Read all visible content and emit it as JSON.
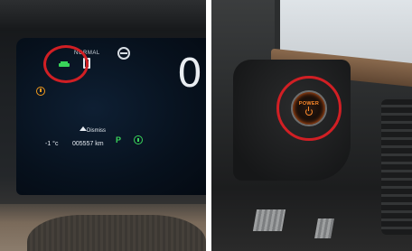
{
  "left_photo": {
    "mode_label": "NORMAL",
    "gear_indicator": "0",
    "nav_label": "Dismiss",
    "outside_temp": "-1 °c",
    "odometer": "005557 km",
    "gear_status": "P",
    "icons": [
      "ev-ready-icon",
      "battery-icon",
      "no-entry-icon",
      "warning-icon",
      "home-icon",
      "info-icon"
    ],
    "colors": {
      "status_green": "#39d45a",
      "warning_orange": "#f19a1d",
      "highlight_red": "#d11f24"
    }
  },
  "right_photo": {
    "button_label": "POWER",
    "icons": [
      "power-icon"
    ],
    "colors": {
      "button_glow": "#ff8a2a",
      "highlight_red": "#d11f24"
    }
  }
}
